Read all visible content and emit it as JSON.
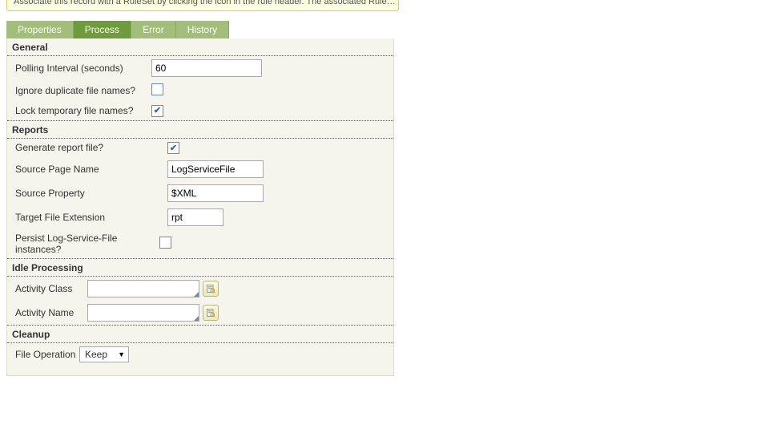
{
  "hint": "Associate this record with a RuleSet by clicking the icon in the rule header. The associated Rule…",
  "tabs": {
    "items": [
      {
        "label": "Properties"
      },
      {
        "label": "Process"
      },
      {
        "label": "Error"
      },
      {
        "label": "History"
      }
    ],
    "active_index": 1
  },
  "general": {
    "title": "General",
    "polling_label": "Polling Interval (seconds)",
    "polling_value": "60",
    "ignore_label": "Ignore duplicate file names?",
    "ignore_checked": false,
    "lock_label": "Lock temporary file names?",
    "lock_checked": true
  },
  "reports": {
    "title": "Reports",
    "generate_label": "Generate report file?",
    "generate_checked": true,
    "source_page_label": "Source Page Name",
    "source_page_value": "LogServiceFile",
    "source_prop_label": "Source Property",
    "source_prop_value": "$XML",
    "target_ext_label": "Target File Extension",
    "target_ext_value": "rpt",
    "persist_label": "Persist Log-Service-File instances?",
    "persist_checked": false
  },
  "idle": {
    "title": "Idle Processing",
    "class_label": "Activity Class",
    "class_value": "",
    "name_label": "Activity Name",
    "name_value": ""
  },
  "cleanup": {
    "title": "Cleanup",
    "op_label": "File Operation",
    "op_value": "Keep"
  },
  "glyphs": {
    "check": "✔",
    "caret": "▼"
  }
}
